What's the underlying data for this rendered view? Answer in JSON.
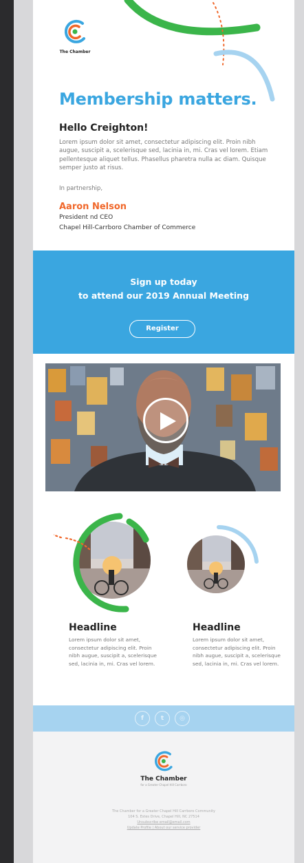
{
  "brand": {
    "name": "The Chamber",
    "footer_subtitle": "for a Greater Chapel Hill Carrboro",
    "colors": {
      "blue": "#3aa6e0",
      "green": "#3bb54a",
      "orange": "#f0672a",
      "light_blue": "#a6d3f0"
    }
  },
  "intro": {
    "headline": "Membership matters.",
    "greeting": "Hello Creighton!",
    "body": "Lorem ipsum dolor sit amet, consectetur adipiscing elit. Proin nibh augue, suscipit a, scelerisque sed, lacinia in, mi. Cras vel lorem. Etiam pellentesque aliquet tellus. Phasellus pharetra nulla ac diam. Quisque semper justo at risus.",
    "closing": "In partnership,",
    "signer_name": "Aaron Nelson",
    "signer_title": "President nd CEO",
    "signer_org": "Chapel Hill-Carrboro Chamber of Commerce"
  },
  "cta": {
    "line1": "Sign up today",
    "line2": "to attend our 2019 Annual Meeting",
    "button_label": "Register"
  },
  "video": {
    "play_icon": "play-icon"
  },
  "features": [
    {
      "title": "Headline",
      "text": "Lorem ipsum dolor sit amet, consectetur adipiscing elit. Proin nibh augue, suscipit a, scelerisque sed, lacinia in, mi. Cras vel lorem."
    },
    {
      "title": "Headline",
      "text": "Lorem ipsum dolor sit amet, consectetur adipiscing elit. Proin nibh augue, suscipit a, scelerisque sed, lacinia in, mi. Cras vel lorem."
    }
  ],
  "social": [
    {
      "icon": "facebook-icon",
      "glyph": "f"
    },
    {
      "icon": "twitter-icon",
      "glyph": "t"
    },
    {
      "icon": "instagram-icon",
      "glyph": "◎"
    }
  ],
  "footer": {
    "org_line": "The Chamber for a Greater Chapel Hill Carrboro Community",
    "address_line": "104 S. Estes Drive, Chapel Hill, NC 27514",
    "unsubscribe": "Unsubscribe email@email.com",
    "links": "Update Profile | About our service provider"
  }
}
